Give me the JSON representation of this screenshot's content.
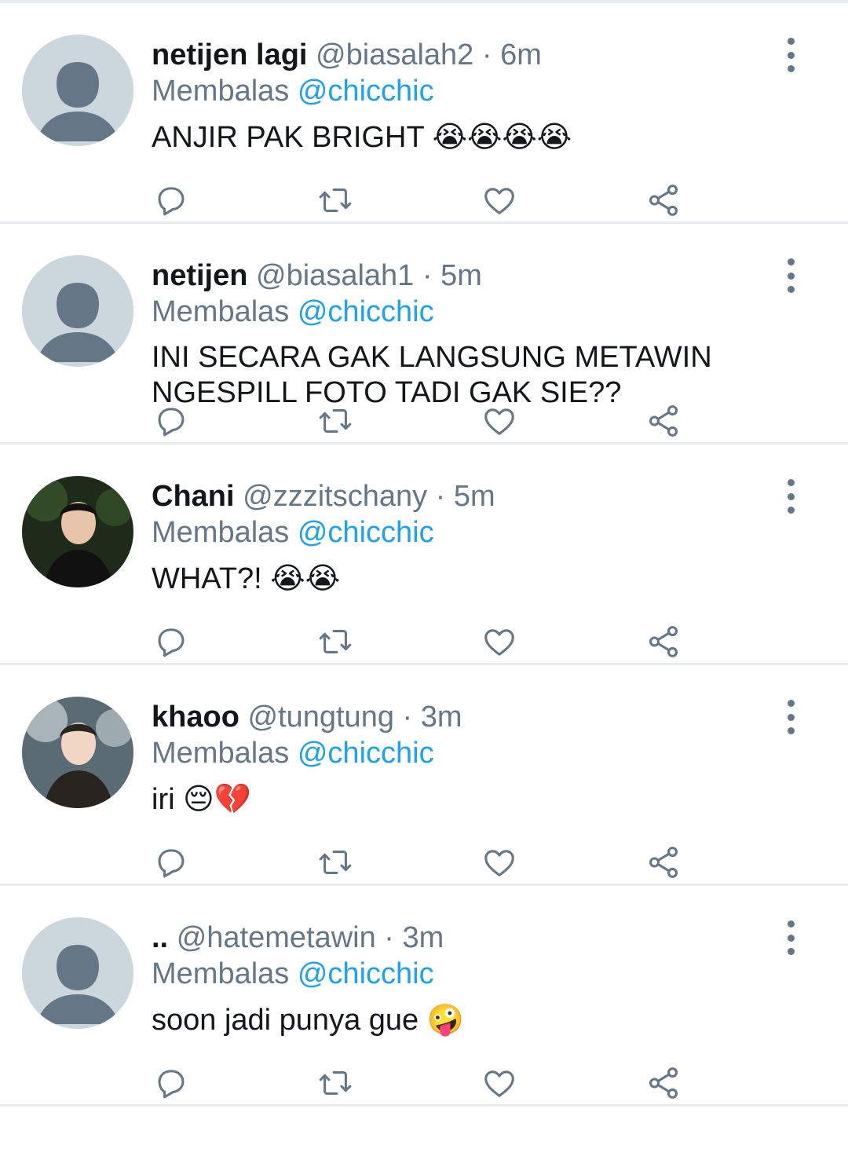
{
  "tweets": [
    {
      "name": "netijen lagi",
      "handle": "@biasalah2",
      "time": "6m",
      "reply_prefix": "Membalas",
      "reply_to": "@chicchic",
      "text": "ANJIR PAK BRIGHT",
      "emojis": "😭😭😭😭",
      "avatar": "default-avatar"
    },
    {
      "name": "netijen",
      "handle": "@biasalah1",
      "time": "5m",
      "reply_prefix": "Membalas",
      "reply_to": "@chicchic",
      "text": "INI SECARA GAK LANGSUNG METAWIN\nNGESPILL FOTO TADI GAK SIE??",
      "emojis": "",
      "avatar": "default-avatar"
    },
    {
      "name": "Chani",
      "handle": "@zzzitschany",
      "time": "5m",
      "reply_prefix": "Membalas",
      "reply_to": "@chicchic",
      "text": "WHAT?!",
      "emojis": "😭😭",
      "avatar": "photo-avatar"
    },
    {
      "name": "khaoo",
      "handle": "@tungtung",
      "time": "3m",
      "reply_prefix": "Membalas",
      "reply_to": "@chicchic",
      "text": "iri",
      "emojis": "😔💔",
      "avatar": "photo-avatar"
    },
    {
      "name": "..",
      "handle": "@hatemetawin",
      "time": "3m",
      "reply_prefix": "Membalas",
      "reply_to": "@chicchic",
      "text": "soon jadi punya gue",
      "emojis": "🤪",
      "avatar": "default-avatar"
    }
  ],
  "icons": {
    "reply": "reply-icon",
    "retweet": "retweet-icon",
    "like": "like-icon",
    "share": "share-icon",
    "more": "more-vertical-icon"
  },
  "colors": {
    "text_primary": "#14171a",
    "text_secondary": "#657786",
    "mention": "#1da1f2",
    "divider": "#e6ecf0",
    "default_avatar_bg": "#ccd6dd"
  }
}
